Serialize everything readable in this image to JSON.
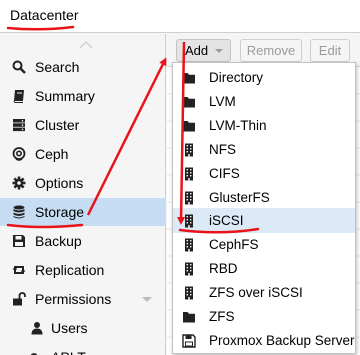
{
  "window": {
    "title": "Datacenter"
  },
  "sidebar": {
    "items": [
      {
        "label": "Search",
        "icon": "search-icon"
      },
      {
        "label": "Summary",
        "icon": "book-icon"
      },
      {
        "label": "Cluster",
        "icon": "server-icon"
      },
      {
        "label": "Ceph",
        "icon": "ceph-icon"
      },
      {
        "label": "Options",
        "icon": "gear-icon"
      },
      {
        "label": "Storage",
        "icon": "database-icon",
        "selected": true
      },
      {
        "label": "Backup",
        "icon": "floppy-icon"
      },
      {
        "label": "Replication",
        "icon": "retweet-icon"
      },
      {
        "label": "Permissions",
        "icon": "unlock-icon",
        "expandable": true
      },
      {
        "label": "Users",
        "icon": "user-icon"
      },
      {
        "label": "API T",
        "icon": "key-icon"
      }
    ]
  },
  "toolbar": {
    "add_label": "Add",
    "remove_label": "Remove",
    "edit_label": "Edit"
  },
  "add_menu": {
    "items": [
      {
        "label": "Directory",
        "icon": "folder-icon"
      },
      {
        "label": "LVM",
        "icon": "folder-icon"
      },
      {
        "label": "LVM-Thin",
        "icon": "folder-icon"
      },
      {
        "label": "NFS",
        "icon": "building-icon"
      },
      {
        "label": "CIFS",
        "icon": "building-icon"
      },
      {
        "label": "GlusterFS",
        "icon": "building-icon"
      },
      {
        "label": "iSCSI",
        "icon": "building-icon",
        "highlighted": true
      },
      {
        "label": "CephFS",
        "icon": "building-icon"
      },
      {
        "label": "RBD",
        "icon": "building-icon"
      },
      {
        "label": "ZFS over iSCSI",
        "icon": "building-icon"
      },
      {
        "label": "ZFS",
        "icon": "folder-icon"
      },
      {
        "label": "Proxmox Backup Server",
        "icon": "floppy-icon"
      }
    ]
  },
  "colors": {
    "selected_bg": "#c5dcf2",
    "highlight_bg": "#dce9f6",
    "annotation": "#e8141a",
    "icon": "#222222"
  }
}
